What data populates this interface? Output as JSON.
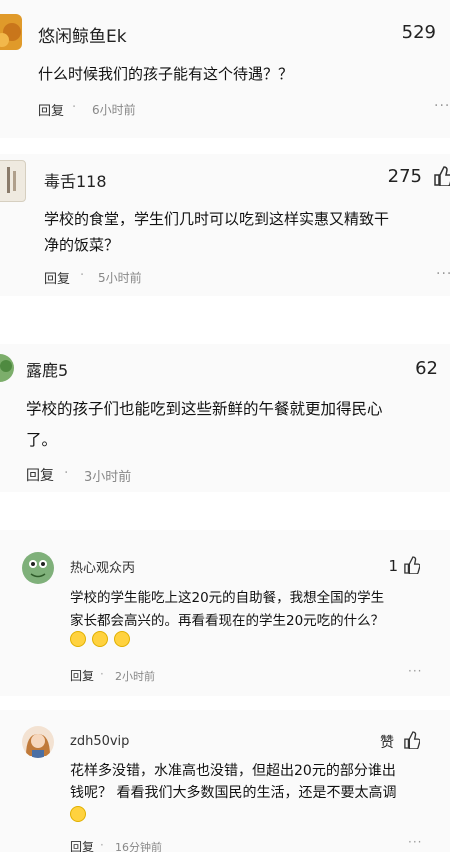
{
  "comments": [
    {
      "username": "悠闲鲸鱼Ek",
      "likes": "529",
      "text_lines": [
        "什么时候我们的孩子能有这个待遇？？"
      ],
      "reply_label": "回复",
      "time": "6小时前",
      "avatar_icon": "orange-avatar-icon"
    },
    {
      "username": "毒舌118",
      "likes": "275",
      "text_lines": [
        "学校的食堂，学生们几时可以吃到这样实惠又精致干",
        "净的饭菜？"
      ],
      "reply_label": "回复",
      "time": "5小时前",
      "avatar_icon": "book-cover-avatar-icon"
    },
    {
      "username": "露鹿5",
      "likes": "62",
      "text_lines": [
        "学校的孩子们也能吃到这些新鲜的午餐就更加得民心",
        "了。"
      ],
      "reply_label": "回复",
      "time": "3小时前",
      "avatar_icon": "green-avatar-icon"
    },
    {
      "username": "热心观众丙",
      "likes": "1",
      "text_lines": [
        "学校的学生能吃上这20元的自助餐，我想全国的学生",
        "家长都会高兴的。再看看现在的学生20元吃的什么？"
      ],
      "reply_label": "回复",
      "time": "2小时前",
      "avatar_icon": "frog-avatar-icon",
      "emojis": [
        "crying-emoji-icon",
        "crying-emoji-icon",
        "crying-emoji-icon"
      ]
    },
    {
      "username": "zdh50vip",
      "likes": "赞",
      "text_lines": [
        "花样多没错，水准高也没错，但超出20元的部分谁出",
        "钱呢？ 看看我们大多数国民的生活，还是不要太高调"
      ],
      "reply_label": "回复",
      "time": "16分钟前",
      "avatar_icon": "girl-avatar-icon",
      "emojis": [
        "grimace-emoji-icon"
      ]
    }
  ],
  "icons": {
    "like": "thumbs-up-icon",
    "more": "more-options-icon"
  },
  "separator": "·",
  "colors": {
    "card_bg": "#fafafa",
    "gap_bg": "#ffffff",
    "secondary_text": "#888888"
  }
}
